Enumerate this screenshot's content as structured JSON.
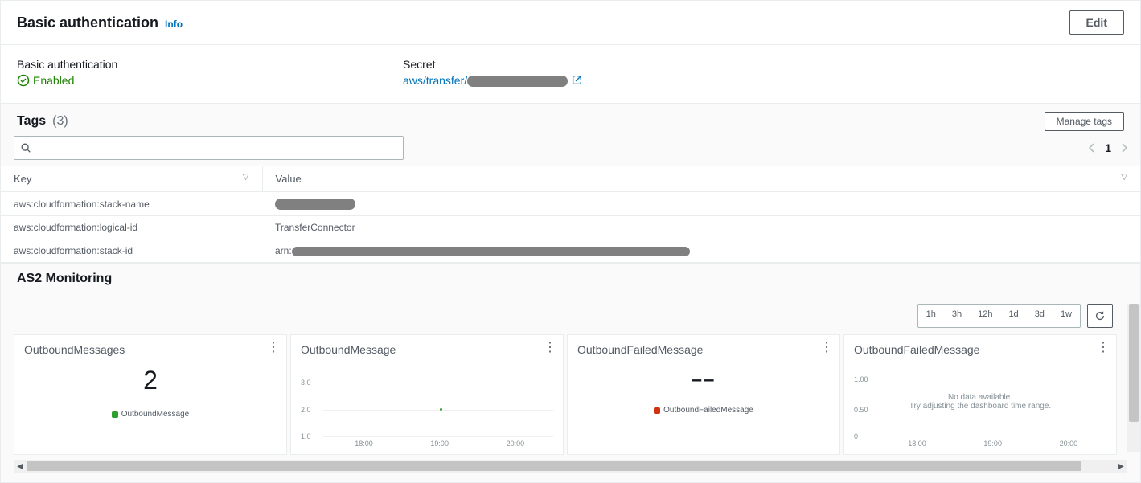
{
  "auth": {
    "panel_title": "Basic authentication",
    "info_label": "Info",
    "edit_label": "Edit",
    "status_label": "Basic authentication",
    "status_value": "Enabled",
    "secret_label": "Secret",
    "secret_link_prefix": "aws/transfer/"
  },
  "tags": {
    "title": "Tags",
    "count": "(3)",
    "manage_label": "Manage tags",
    "page_current": "1",
    "col_key": "Key",
    "col_value": "Value",
    "rows": [
      {
        "key": "aws:cloudformation:stack-name",
        "value": ""
      },
      {
        "key": "aws:cloudformation:logical-id",
        "value": "TransferConnector"
      },
      {
        "key": "aws:cloudformation:stack-id",
        "value": "arn:"
      }
    ]
  },
  "monitoring": {
    "title": "AS2 Monitoring",
    "ranges": [
      "1h",
      "3h",
      "12h",
      "1d",
      "3d",
      "1w"
    ],
    "charts": [
      {
        "title": "OutboundMessages",
        "kind": "number",
        "value": "2",
        "legend": "OutboundMessage",
        "legend_color": "green"
      },
      {
        "title": "OutboundMessage",
        "kind": "line",
        "yticks": [
          "3.0",
          "2.0",
          "1.0"
        ],
        "xticks": [
          "18:00",
          "19:00",
          "20:00"
        ],
        "point": {
          "x_pct": 55,
          "y_pct": 50
        }
      },
      {
        "title": "OutboundFailedMessage",
        "kind": "empty-number",
        "value": "––",
        "legend": "OutboundFailedMessage",
        "legend_color": "red"
      },
      {
        "title": "OutboundFailedMessage",
        "kind": "empty-line",
        "yticks": [
          "1.00",
          "0.50",
          "0"
        ],
        "xticks": [
          "18:00",
          "19:00",
          "20:00"
        ],
        "nodata_line1": "No data available.",
        "nodata_line2": "Try adjusting the dashboard time range."
      }
    ]
  },
  "chart_data": [
    {
      "type": "bar",
      "title": "OutboundMessages",
      "categories": [
        "OutboundMessage"
      ],
      "values": [
        2
      ]
    },
    {
      "type": "line",
      "title": "OutboundMessage",
      "x": [
        "18:00",
        "19:00",
        "20:00"
      ],
      "series": [
        {
          "name": "OutboundMessage",
          "values": [
            null,
            2,
            null
          ]
        }
      ],
      "ylim": [
        1.0,
        3.0
      ],
      "ylabel": "",
      "xlabel": ""
    },
    {
      "type": "bar",
      "title": "OutboundFailedMessage",
      "categories": [
        "OutboundFailedMessage"
      ],
      "values": []
    },
    {
      "type": "line",
      "title": "OutboundFailedMessage",
      "x": [
        "18:00",
        "19:00",
        "20:00"
      ],
      "series": [
        {
          "name": "OutboundFailedMessage",
          "values": [
            null,
            null,
            null
          ]
        }
      ],
      "ylim": [
        0,
        1.0
      ],
      "ylabel": "",
      "xlabel": "",
      "note": "No data available. Try adjusting the dashboard time range."
    }
  ]
}
